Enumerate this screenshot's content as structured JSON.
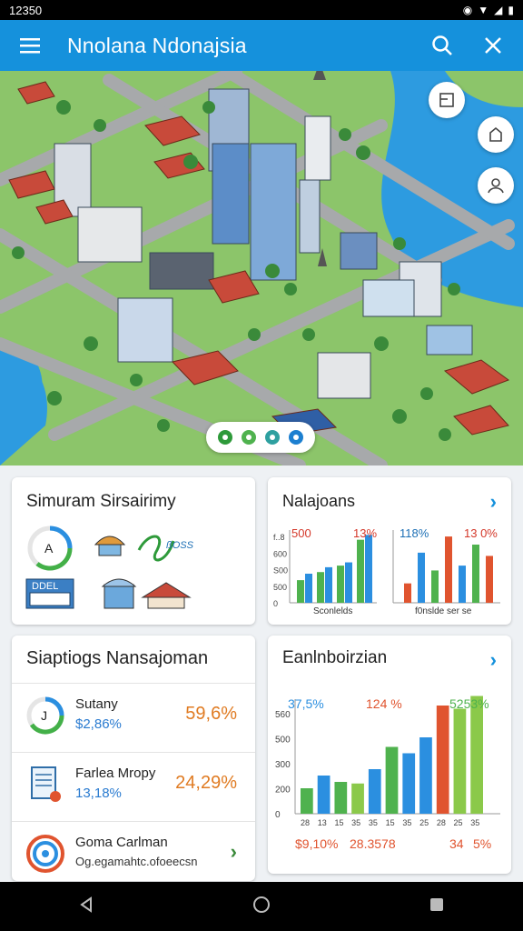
{
  "status_bar": {
    "time": "12350"
  },
  "app_bar": {
    "title": "Nnolana Ndonajsia"
  },
  "map": {
    "pager_dots": 4
  },
  "card1": {
    "title": "Simuram Sirsairimy",
    "badge_letter": "A",
    "logo_text": "ßOSS",
    "sign_text": "DDEL"
  },
  "card2": {
    "title": "Nalajoans",
    "chart_left": {
      "label_left": "500",
      "label_right": "13%",
      "y_ticks": [
        "f..8",
        "600",
        "S00",
        "500",
        "0"
      ],
      "caption": "Sconlelds"
    },
    "chart_right": {
      "label_left": "118%",
      "label_right": "13 0%",
      "caption": "f0nslde ser se"
    }
  },
  "card3": {
    "title": "Siaptiogs Nansajoman",
    "rows": [
      {
        "title": "Sutany",
        "sub": "$2,86%",
        "value": "59,6%",
        "icon_letter": "J"
      },
      {
        "title": "Farlea Mropy",
        "sub": "13,18%",
        "value": "24,29%"
      },
      {
        "title": "Goma Carlman",
        "sub": "Og.egamahtc.ofoeecsn"
      }
    ]
  },
  "card4": {
    "title": "Eanlnboirzian",
    "top_labels": [
      "37,5%",
      "124 %",
      "5253%"
    ],
    "y_ticks": [
      "560",
      "500",
      "300",
      "200",
      "0"
    ],
    "x_ticks": [
      "28",
      "13",
      "15",
      "35",
      "35",
      "15",
      "35",
      "25",
      "28",
      "25",
      "35"
    ],
    "bottom_labels": [
      "$9,10%",
      "28.3578",
      "34",
      "5%"
    ]
  },
  "chart_data": [
    {
      "type": "bar",
      "title": "500 13%",
      "categories": [
        "1",
        "2",
        "3",
        "4"
      ],
      "series": [
        {
          "values": [
            140,
            190,
            230,
            390
          ]
        },
        {
          "values": [
            180,
            220,
            250,
            420
          ]
        }
      ],
      "y_ticks": [
        "f..8",
        "600",
        "S00",
        "500",
        "0"
      ],
      "xlabel": "Sconlelds"
    },
    {
      "type": "bar",
      "title": "118% 13 0%",
      "categories": [
        "1",
        "2",
        "3",
        "4",
        "5",
        "6",
        "7"
      ],
      "values": [
        120,
        310,
        200,
        410,
        230,
        360,
        290
      ],
      "xlabel": "f0nslde ser se"
    },
    {
      "type": "bar",
      "categories": [
        "28",
        "13",
        "15",
        "35",
        "35",
        "15",
        "35",
        "25",
        "28",
        "25",
        "35"
      ],
      "values": [
        80,
        120,
        100,
        95,
        140,
        210,
        190,
        240,
        340,
        330,
        370
      ],
      "y_ticks": [
        "560",
        "500",
        "300",
        "200",
        "0"
      ],
      "annotations": [
        "37,5%",
        "124 %",
        "5253%",
        "$9,10%",
        "28.3578",
        "34",
        "5%"
      ]
    }
  ]
}
